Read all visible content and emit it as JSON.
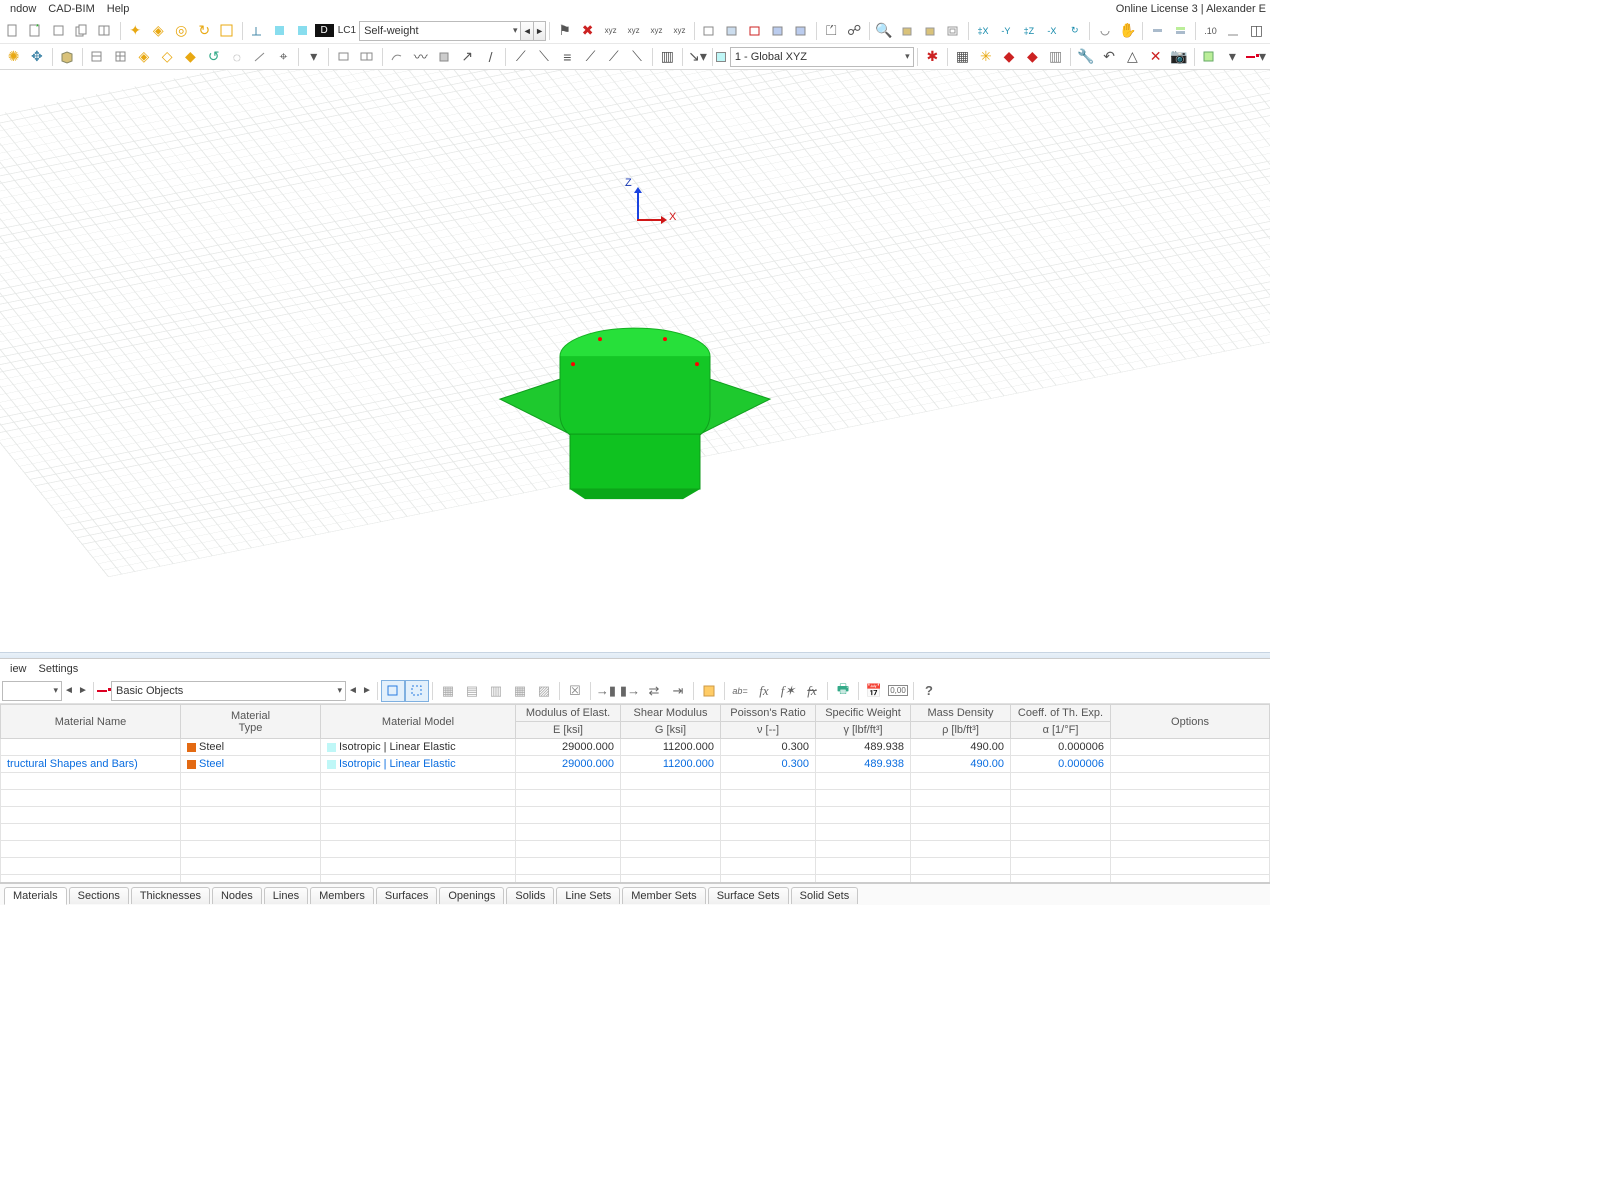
{
  "menubar": {
    "items": [
      "ndow",
      "CAD-BIM",
      "Help"
    ],
    "license": "Online License 3 | Alexander E"
  },
  "toolbar1": {
    "lc_badge": "D",
    "lc_code": "LC1",
    "lc_name": "Self-weight",
    "dec_label": ".10"
  },
  "toolbar2": {
    "cs_label": "1 - Global XYZ"
  },
  "panel": {
    "menu": [
      "iew",
      "Settings"
    ],
    "basic_objects": "Basic Objects"
  },
  "table": {
    "headers1": [
      "Material Name",
      "Material\nType",
      "Material Model",
      "Modulus of Elast.",
      "Shear Modulus",
      "Poisson's Ratio",
      "Specific Weight",
      "Mass Density",
      "Coeff. of Th. Exp.",
      "Options"
    ],
    "headers2": [
      "",
      "",
      "",
      "E [ksi]",
      "G [ksi]",
      "ν [--]",
      "γ [lbf/ft³]",
      "ρ [lb/ft³]",
      "α [1/°F]",
      ""
    ],
    "rows": [
      {
        "name": "",
        "type": "Steel",
        "model": "Isotropic | Linear Elastic",
        "E": "29000.000",
        "G": "11200.000",
        "nu": "0.300",
        "gamma": "489.938",
        "rho": "490.00",
        "alpha": "0.000006",
        "hl": false
      },
      {
        "name": "tructural Shapes and Bars)",
        "type": "Steel",
        "model": "Isotropic | Linear Elastic",
        "E": "29000.000",
        "G": "11200.000",
        "nu": "0.300",
        "gamma": "489.938",
        "rho": "490.00",
        "alpha": "0.000006",
        "hl": true
      }
    ]
  },
  "tabs": [
    "Materials",
    "Sections",
    "Thicknesses",
    "Nodes",
    "Lines",
    "Members",
    "Surfaces",
    "Openings",
    "Solids",
    "Line Sets",
    "Member Sets",
    "Surface Sets",
    "Solid Sets"
  ],
  "axis": {
    "x": "X",
    "z": "Z"
  }
}
